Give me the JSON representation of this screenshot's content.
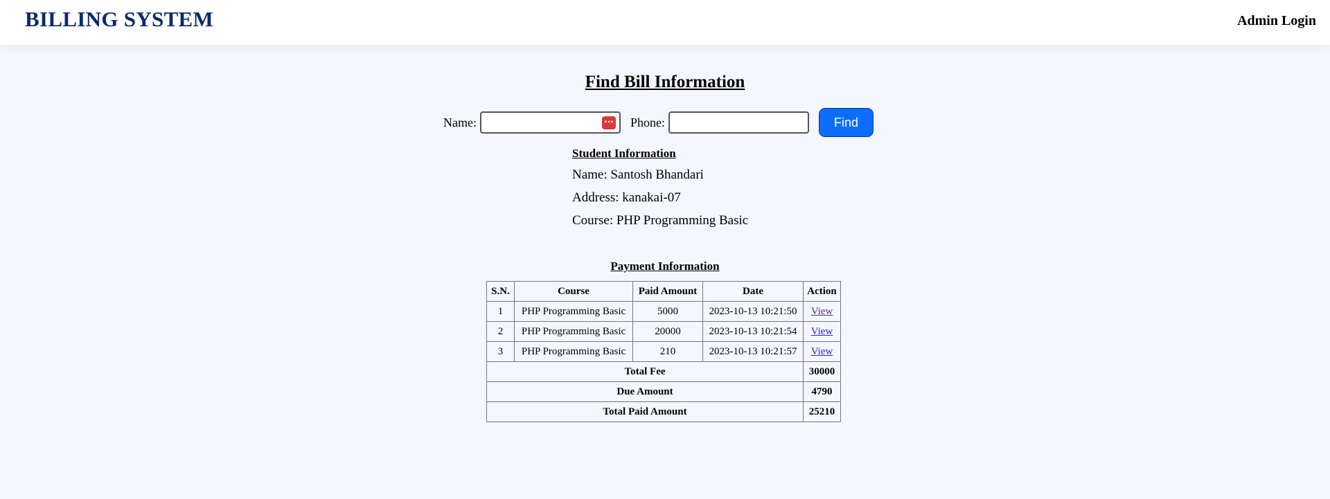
{
  "header": {
    "brand": "BILLING SYSTEM",
    "admin_login": "Admin Login"
  },
  "search": {
    "title": "Find Bill Information",
    "name_label": "Name:",
    "name_value": "",
    "phone_label": "Phone:",
    "phone_value": "",
    "find_label": "Find",
    "password_manager_icon": "···"
  },
  "student": {
    "title": "Student Information",
    "name": "Name: Santosh Bhandari",
    "address": "Address: kanakai-07",
    "course": "Course: PHP Programming Basic"
  },
  "payment": {
    "title": "Payment Information",
    "columns": [
      "S.N.",
      "Course",
      "Paid Amount",
      "Date",
      "Action"
    ],
    "rows": [
      {
        "sn": "1",
        "course": "PHP Programming Basic",
        "amount": "5000",
        "date": "2023-10-13 10:21:50",
        "action": "View"
      },
      {
        "sn": "2",
        "course": "PHP Programming Basic",
        "amount": "20000",
        "date": "2023-10-13 10:21:54",
        "action": "View"
      },
      {
        "sn": "3",
        "course": "PHP Programming Basic",
        "amount": "210",
        "date": "2023-10-13 10:21:57",
        "action": "View"
      }
    ],
    "totals": [
      {
        "label": "Total Fee",
        "value": "30000"
      },
      {
        "label": "Due Amount",
        "value": "4790"
      },
      {
        "label": "Total Paid Amount",
        "value": "25210"
      }
    ]
  },
  "colors": {
    "brand": "#0b2a6b",
    "page_background": "#f4f7fd",
    "find_button": "#0d6efd",
    "link": "#2b1ecf",
    "visited_link": "#5b2a86",
    "password_badge": "#d93b3b"
  }
}
